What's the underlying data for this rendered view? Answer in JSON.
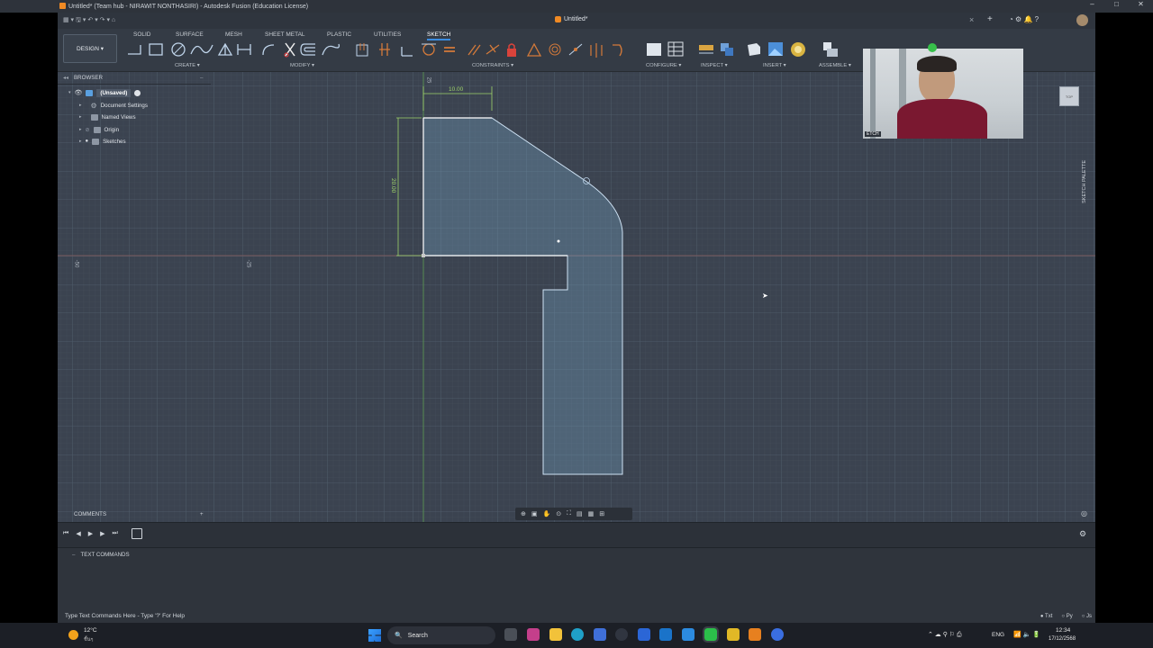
{
  "window": {
    "title": "Untitled* (Team hub - NIRAWIT NONTHASIRI) - Autodesk Fusion (Education License)",
    "document_tab": "Untitled*",
    "controls": [
      "–",
      "□",
      "✕"
    ]
  },
  "ribbon": {
    "workspace": "DESIGN",
    "tabs": [
      "SOLID",
      "SURFACE",
      "MESH",
      "SHEET METAL",
      "PLASTIC",
      "UTILITIES",
      "SKETCH"
    ],
    "active_tab": "SKETCH",
    "groups": [
      "CREATE",
      "MODIFY",
      "CONSTRAINTS",
      "CONFIGURE",
      "INSPECT",
      "INSERT",
      "ASSEMBLE"
    ]
  },
  "browser": {
    "header": "BROWSER",
    "items": [
      {
        "label": "(Unsaved)",
        "icon": "component-icon",
        "selected": true
      },
      {
        "label": "Document Settings",
        "icon": "gear-icon"
      },
      {
        "label": "Named Views",
        "icon": "folder-icon"
      },
      {
        "label": "Origin",
        "icon": "folder-icon"
      },
      {
        "label": "Sketches",
        "icon": "folder-icon"
      }
    ]
  },
  "sketch": {
    "dim_horizontal": "10.00",
    "dim_vertical": "20.00",
    "left_marker_a": "-50",
    "left_marker_b": "-25",
    "top_marker": "25"
  },
  "comments": {
    "label": "COMMENTS"
  },
  "text_commands": {
    "header": "TEXT COMMANDS",
    "placeholder": "Type Text Commands Here - Type '?' For Help",
    "modes": [
      "Txt",
      "Py",
      "Js"
    ]
  },
  "palette": {
    "label": "SKETCH PALETTE"
  },
  "viewcube": {
    "label": "TOP"
  },
  "webcam": {
    "badge": "ETCH"
  },
  "taskbar": {
    "weather_temp": "12°C",
    "weather_text": "ชื้นๆ",
    "search": "Search",
    "language": "ENG",
    "time": "12:34",
    "date": "17/12/2568"
  }
}
